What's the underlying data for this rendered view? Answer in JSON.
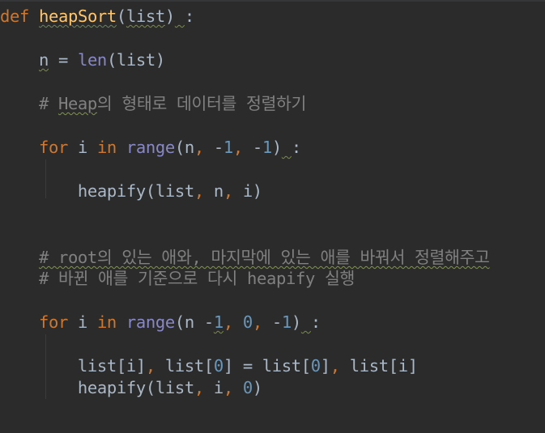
{
  "editor": {
    "lines": [
      {
        "tokens": [
          {
            "t": "def",
            "c": "kw"
          },
          {
            "t": " ",
            "c": "pl"
          },
          {
            "t": "heapSort",
            "c": "fnname"
          },
          {
            "t": "(",
            "c": "pl"
          },
          {
            "t": "list",
            "c": "pl squig"
          },
          {
            "t": ")",
            "c": "pl"
          },
          {
            "t": " ",
            "c": "pl squig"
          },
          {
            "t": ":",
            "c": "pl"
          }
        ]
      },
      {
        "tokens": [
          {
            "t": "    ",
            "c": "pl"
          },
          {
            "t": "n",
            "c": "pl squig"
          },
          {
            "t": " = ",
            "c": "pl"
          },
          {
            "t": "len",
            "c": "bi"
          },
          {
            "t": "(list)",
            "c": "pl"
          }
        ]
      },
      {
        "tokens": [
          {
            "t": "    # ",
            "c": "cm"
          },
          {
            "t": "Heap",
            "c": "cm cm-squig"
          },
          {
            "t": "의 형태로 데이터를 정렬하기",
            "c": "cm"
          }
        ]
      },
      {
        "tokens": [
          {
            "t": "    ",
            "c": "pl"
          },
          {
            "t": "for",
            "c": "kw"
          },
          {
            "t": " i ",
            "c": "pl"
          },
          {
            "t": "in",
            "c": "kw"
          },
          {
            "t": " ",
            "c": "pl"
          },
          {
            "t": "range",
            "c": "bi"
          },
          {
            "t": "(n",
            "c": "pl"
          },
          {
            "t": ",",
            "c": "kw"
          },
          {
            "t": " -",
            "c": "pl"
          },
          {
            "t": "1",
            "c": "num"
          },
          {
            "t": ",",
            "c": "kw"
          },
          {
            "t": " -",
            "c": "pl"
          },
          {
            "t": "1",
            "c": "num"
          },
          {
            "t": ")",
            "c": "pl"
          },
          {
            "t": " ",
            "c": "pl squig"
          },
          {
            "t": ":",
            "c": "pl"
          }
        ]
      },
      {
        "tokens": [
          {
            "t": "        heapify(list",
            "c": "pl"
          },
          {
            "t": ",",
            "c": "kw"
          },
          {
            "t": " n",
            "c": "pl"
          },
          {
            "t": ",",
            "c": "kw"
          },
          {
            "t": " i)",
            "c": "pl"
          }
        ]
      },
      {
        "tokens": [
          {
            "t": "    ",
            "c": "cm"
          },
          {
            "t": "# root의 있는 애와, 마지막에 있는 애를 바꿔서 정렬해주고",
            "c": "cm cm-squig"
          }
        ]
      },
      {
        "tokens": [
          {
            "t": "    # 바뀐 애를 기준으로 다시 heapify 실행",
            "c": "cm"
          }
        ]
      },
      {
        "tokens": [
          {
            "t": "    ",
            "c": "pl"
          },
          {
            "t": "for",
            "c": "kw"
          },
          {
            "t": " i ",
            "c": "pl"
          },
          {
            "t": "in",
            "c": "kw"
          },
          {
            "t": " ",
            "c": "pl"
          },
          {
            "t": "range",
            "c": "bi"
          },
          {
            "t": "(n -",
            "c": "pl"
          },
          {
            "t": "1",
            "c": "num squig"
          },
          {
            "t": ",",
            "c": "kw"
          },
          {
            "t": " ",
            "c": "pl"
          },
          {
            "t": "0",
            "c": "num"
          },
          {
            "t": ",",
            "c": "kw"
          },
          {
            "t": " -",
            "c": "pl"
          },
          {
            "t": "1",
            "c": "num"
          },
          {
            "t": ")",
            "c": "pl"
          },
          {
            "t": " ",
            "c": "pl squig"
          },
          {
            "t": ":",
            "c": "pl"
          }
        ]
      },
      {
        "tokens": [
          {
            "t": "        list[i]",
            "c": "pl"
          },
          {
            "t": ",",
            "c": "kw"
          },
          {
            "t": " list[",
            "c": "pl"
          },
          {
            "t": "0",
            "c": "num"
          },
          {
            "t": "] = list[",
            "c": "pl"
          },
          {
            "t": "0",
            "c": "num"
          },
          {
            "t": "]",
            "c": "pl"
          },
          {
            "t": ",",
            "c": "kw"
          },
          {
            "t": " list[i]",
            "c": "pl"
          }
        ]
      },
      {
        "tokens": [
          {
            "t": "        heapify(list",
            "c": "pl"
          },
          {
            "t": ",",
            "c": "kw"
          },
          {
            "t": " i",
            "c": "pl"
          },
          {
            "t": ",",
            "c": "kw"
          },
          {
            "t": " ",
            "c": "pl"
          },
          {
            "t": "0",
            "c": "num"
          },
          {
            "t": ")",
            "c": "pl"
          }
        ]
      }
    ]
  },
  "colors": {
    "background": "#2b2b2b",
    "keyword": "#cc7832",
    "function": "#ffc66d",
    "builtin": "#8888c6",
    "number": "#6897bb",
    "comment": "#808080",
    "text": "#a9b7c6"
  }
}
